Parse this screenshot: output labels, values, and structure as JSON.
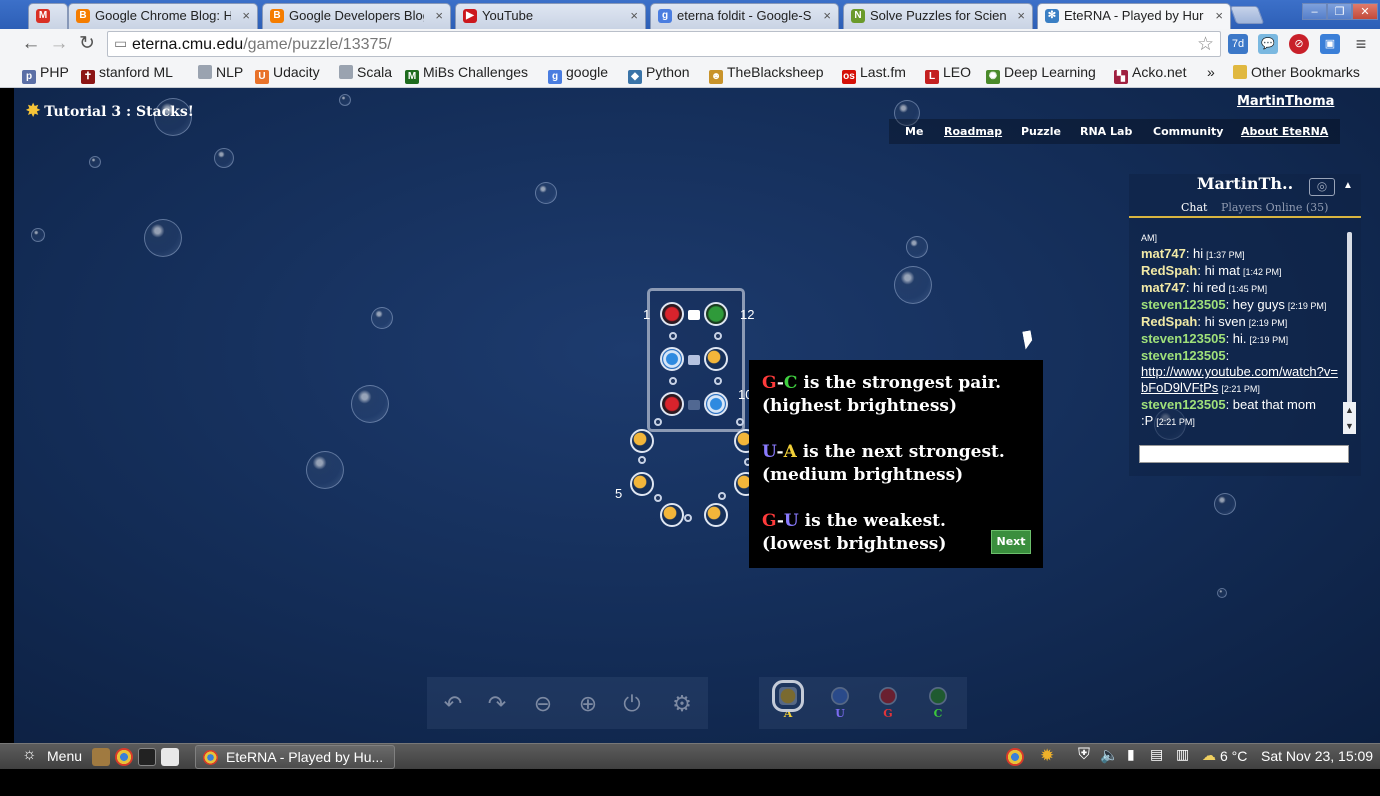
{
  "browser": {
    "tabs": [
      {
        "label": "",
        "icon": "gmail-icon",
        "color": "#d93025",
        "fav": "M",
        "x": 28,
        "w": 40
      },
      {
        "label": "Google Chrome Blog: H",
        "icon": "blogger-icon",
        "color": "#f57d00",
        "fav": "B"
      },
      {
        "label": "Google Developers Blog",
        "icon": "blogger-icon",
        "color": "#f57d00",
        "fav": "B"
      },
      {
        "label": "YouTube",
        "icon": "youtube-icon",
        "color": "#cc181e",
        "fav": "▶"
      },
      {
        "label": "eterna foldit - Google-S",
        "icon": "google-icon",
        "color": "#4a7de0",
        "fav": "g"
      },
      {
        "label": "Solve Puzzles for Scienc",
        "icon": "foldit-icon",
        "color": "#6a9a2a",
        "fav": "N"
      },
      {
        "label": "EteRNA - Played by Hur",
        "icon": "eterna-icon",
        "color": "#3a7fc4",
        "fav": "✻"
      }
    ],
    "url_host": "eterna.cmu.edu",
    "url_path": "/game/puzzle/13375/",
    "bookmarks": [
      {
        "label": "PHP",
        "icon": "php-icon",
        "color": "#5b6fa6"
      },
      {
        "label": "stanford ML",
        "icon": "stanford-icon",
        "color": "#8c1515"
      },
      {
        "label": "NLP",
        "icon": "page-icon",
        "color": "#9aa3b0"
      },
      {
        "label": "Udacity",
        "icon": "udacity-icon",
        "color": "#e8722a"
      },
      {
        "label": "Scala",
        "icon": "page-icon",
        "color": "#9aa3b0"
      },
      {
        "label": "MiBs Challenges",
        "icon": "mibs-icon",
        "color": "#1e6b1e"
      },
      {
        "label": "google",
        "icon": "google-icon",
        "color": "#4a7de0"
      },
      {
        "label": "Python",
        "icon": "python-icon",
        "color": "#3a74a8"
      },
      {
        "label": "TheBlacksheep",
        "icon": "sheep-icon",
        "color": "#c8932a"
      },
      {
        "label": "Last.fm",
        "icon": "lastfm-icon",
        "color": "#d51007"
      },
      {
        "label": "LEO",
        "icon": "leo-icon",
        "color": "#c42020"
      },
      {
        "label": "Deep Learning",
        "icon": "gear-icon",
        "color": "#4a8a2a"
      },
      {
        "label": "Acko.net",
        "icon": "acko-icon",
        "color": "#a02040"
      }
    ],
    "bookmarks_overflow": "»",
    "other_bookmarks": "Other Bookmarks"
  },
  "game": {
    "tutorial_title": "Tutorial 3 : Stacks!",
    "username": "MartinThoma",
    "nav": [
      "Me",
      "Roadmap",
      "Puzzle",
      "RNA Lab",
      "Community",
      "About EteRNA"
    ],
    "chat": {
      "name": "MartinTh..",
      "tab_chat": "Chat",
      "tab_players": "Players Online (35)",
      "messages": [
        {
          "name": "",
          "text": "AM]",
          "time": "",
          "color": "#ffffff"
        },
        {
          "name": "mat747",
          "text": ": hi",
          "time": "[1:37 PM]",
          "color": "#f1e9a6"
        },
        {
          "name": "RedSpah",
          "text": ": hi mat",
          "time": "[1:42 PM]",
          "color": "#f1e9a6"
        },
        {
          "name": "mat747",
          "text": ": hi red",
          "time": "[1:45 PM]",
          "color": "#f1e9a6"
        },
        {
          "name": "steven123505",
          "text": ": hey guys",
          "time": "[2:19 PM]",
          "color": "#9fe07a"
        },
        {
          "name": "RedSpah",
          "text": ": hi sven",
          "time": "[2:19 PM]",
          "color": "#f1e9a6"
        },
        {
          "name": "steven123505",
          "text": ": hi.",
          "time": "[2:19 PM]",
          "color": "#9fe07a"
        },
        {
          "name": "steven123505",
          "text": ":",
          "time": "",
          "color": "#9fe07a"
        },
        {
          "name": "",
          "link": "http://www.youtube.com/watch?v=bFoD9lVFtPs",
          "text": "",
          "time": "[2:21 PM]",
          "color": "#ffffff"
        },
        {
          "name": "steven123505",
          "text": ": beat that mom :P",
          "time": "[2:21 PM]",
          "color": "#9fe07a"
        }
      ]
    },
    "popup": {
      "line1_a": "G",
      "line1_dash": "-",
      "line1_b": "C",
      "line1_rest": " is the strongest pair.",
      "line2": "(highest brightness)",
      "line3_a": "U",
      "line3_dash": "-",
      "line3_b": "A",
      "line3_rest": " is the next strongest.",
      "line4": "(medium brightness)",
      "line5_a": "G",
      "line5_dash": "-",
      "line5_b": "U",
      "line5_rest": " is the weakest.",
      "line6": "(lowest brightness)",
      "next": "Next"
    },
    "indices": [
      "1",
      "12",
      "10",
      "5"
    ],
    "palette": [
      {
        "label": "A",
        "color": "#f2d038",
        "dot": "#7a6a30"
      },
      {
        "label": "U",
        "color": "#7b6bf0",
        "dot": "#2a4a8a"
      },
      {
        "label": "G",
        "color": "#e0343a",
        "dot": "#6a2030"
      },
      {
        "label": "C",
        "color": "#3cc63c",
        "dot": "#1f5a30"
      }
    ],
    "colors": {
      "G": "#ff3b3b",
      "C": "#40d040",
      "U": "#8a7bff",
      "A": "#f2d038"
    }
  },
  "taskbar": {
    "menu": "Menu",
    "window": "EteRNA - Played by Hu...",
    "weather": "6 °C",
    "clock": "Sat Nov 23, 15:09"
  }
}
